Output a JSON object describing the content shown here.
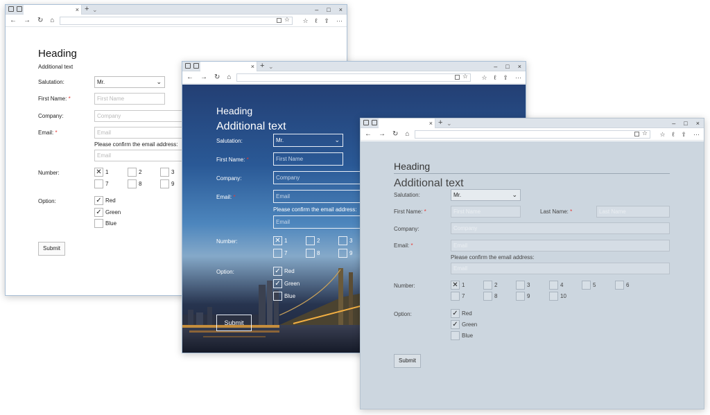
{
  "browser": {
    "tab_close": "×",
    "new_tab": "+",
    "tab_list": "⌄",
    "minimize": "–",
    "maximize": "□",
    "close": "×",
    "back": "←",
    "forward": "→",
    "refresh": "↻",
    "home": "⌂",
    "favorite": "☆",
    "favorites_hub": "☆",
    "notes": "ℓ",
    "share": "⇪",
    "more": "···"
  },
  "form": {
    "heading": "Heading",
    "additional_text": "Additional text",
    "salutation_label": "Salutation:",
    "salutation_value": "Mr.",
    "first_name_label": "First Name:",
    "first_name_placeholder": "First Name",
    "last_name_label": "Last Name:",
    "last_name_placeholder": "Last Name",
    "company_label": "Company:",
    "company_placeholder": "Company",
    "email_label": "Email:",
    "email_placeholder": "Email",
    "confirm_email_text": "Please confirm the email address:",
    "required_mark": "*",
    "number_label": "Number:",
    "numbers": [
      "1",
      "2",
      "3",
      "4",
      "5",
      "6",
      "7",
      "8",
      "9",
      "10"
    ],
    "number_checked": [
      true,
      false,
      false,
      false,
      false,
      false,
      false,
      false,
      false,
      false
    ],
    "option_label": "Option:",
    "options": [
      "Red",
      "Green",
      "Blue"
    ],
    "option_checked": [
      true,
      true,
      false
    ],
    "check_mark_x": "✕",
    "check_mark_tick": "✓",
    "chevron": "⌄",
    "submit": "Submit"
  },
  "colors": {
    "required": "#e53935",
    "window3_background": "#ccd6df",
    "window2_sky_top": "#233f74"
  }
}
